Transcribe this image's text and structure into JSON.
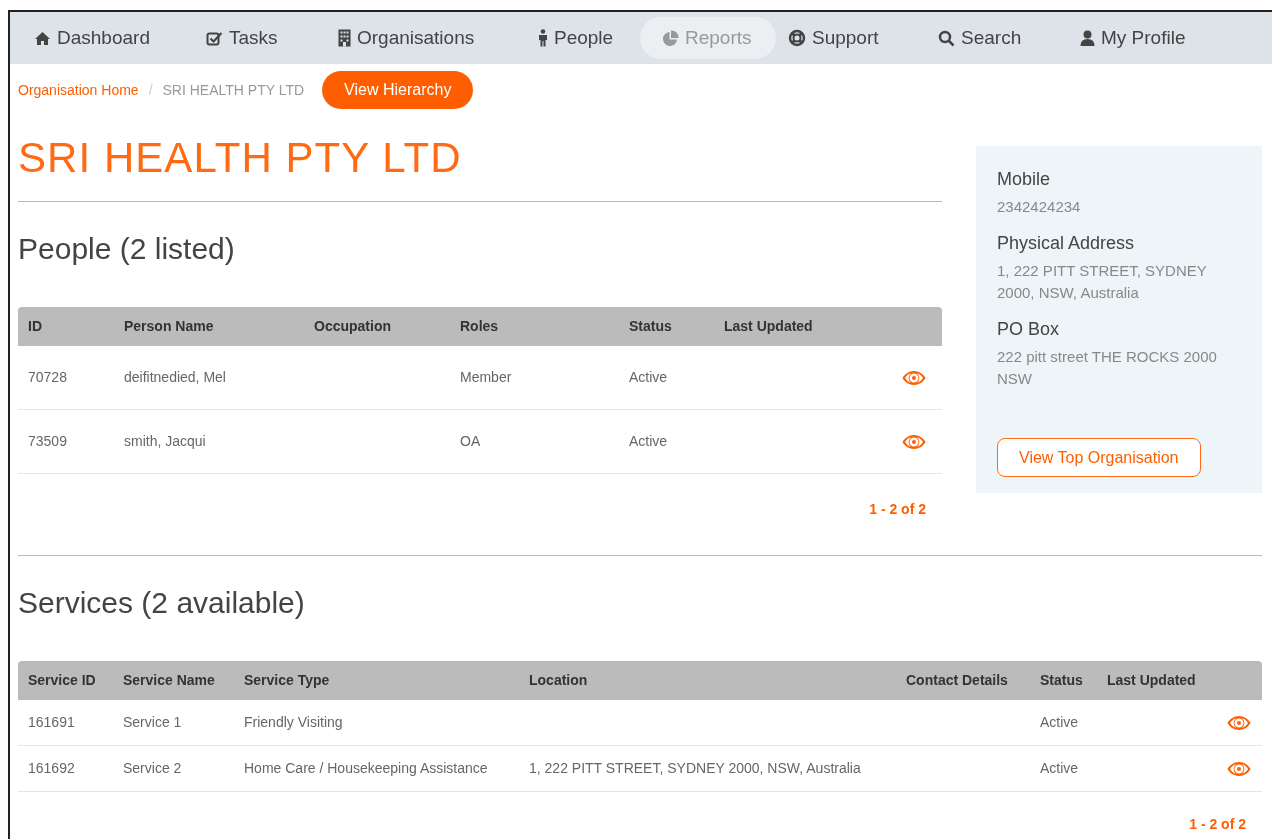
{
  "nav": {
    "items": [
      {
        "label": "Dashboard",
        "selected": false
      },
      {
        "label": "Tasks",
        "selected": false
      },
      {
        "label": "Organisations",
        "selected": false
      },
      {
        "label": "People",
        "selected": false
      },
      {
        "label": "Reports",
        "selected": true
      },
      {
        "label": "Support",
        "selected": false
      },
      {
        "label": "Search",
        "selected": false
      },
      {
        "label": "My Profile",
        "selected": false
      }
    ]
  },
  "breadcrumb": {
    "items": [
      "Organisation Home",
      "SRI HEALTH PTY LTD"
    ],
    "separator": "/",
    "button": "View Hierarchy"
  },
  "title": "SRI HEALTH PTY LTD",
  "people": {
    "heading": "People (2 listed)",
    "columns": [
      "ID",
      "Person Name",
      "Occupation",
      "Roles",
      "Status",
      "Last Updated"
    ],
    "rows": [
      {
        "cells": [
          "70728",
          "deifitnedied, Mel",
          "",
          "Member",
          "Active",
          ""
        ]
      },
      {
        "cells": [
          "73509",
          "smith, Jacqui",
          "",
          "OA",
          "Active",
          ""
        ]
      }
    ],
    "pagination": "1 - 2 of 2"
  },
  "details": {
    "fields": [
      {
        "label": "Mobile",
        "value": "2342424234"
      },
      {
        "label": "Physical Address",
        "value": "1, 222 PITT STREET, SYDNEY 2000, NSW, Australia"
      },
      {
        "label": "PO Box",
        "value": "222 pitt street THE ROCKS 2000 NSW"
      }
    ],
    "button": "View Top Organisation"
  },
  "services": {
    "heading": "Services (2 available)",
    "columns": [
      "Service ID",
      "Service Name",
      "Service Type",
      "Location",
      "Contact Details",
      "Status",
      "Last Updated"
    ],
    "rows": [
      {
        "cells": [
          "161691",
          "Service 1",
          "Friendly Visiting",
          "",
          "",
          "Active",
          ""
        ]
      },
      {
        "cells": [
          "161692",
          "Service 2",
          "Home Care / Housekeeping Assistance",
          "1, 222 PITT STREET, SYDNEY 2000, NSW, Australia",
          "",
          "Active",
          ""
        ]
      }
    ],
    "pagination": "1 - 2 of 2"
  }
}
